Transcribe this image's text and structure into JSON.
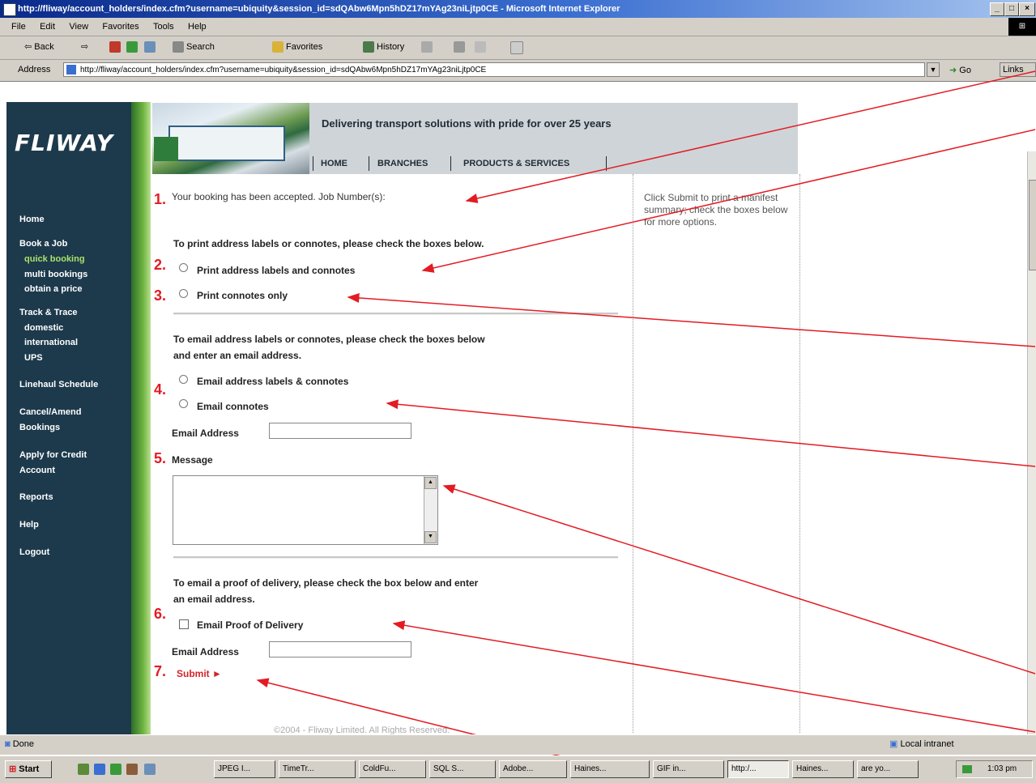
{
  "window": {
    "title": "http://fliway/account_holders/index.cfm?username=ubiquity&session_id=sdQAbw6Mpn5hDZ17mYAg23niLjtp0CE - Microsoft Internet Explorer",
    "minimize": "_",
    "maximize": "□",
    "close": "×"
  },
  "menu": {
    "items": [
      "File",
      "Edit",
      "View",
      "Favorites",
      "Tools",
      "Help"
    ]
  },
  "toolbar": {
    "back": "⇦ Back",
    "forward": "⇨",
    "search": "Search",
    "favorites": "Favorites",
    "history": "History"
  },
  "address": {
    "label": "Address",
    "value": "http://fliway/account_holders/index.cfm?username=ubiquity&session_id=sdQAbw6Mpn5hDZ17mYAg23niLjtp0CE",
    "go": "Go",
    "links": "Links"
  },
  "site": {
    "logo": "FLIWAY",
    "tagline": "Delivering transport solutions with pride for over 25 years",
    "topnav": [
      "HOME",
      "BRANCHES",
      "PRODUCTS & SERVICES"
    ]
  },
  "sidebar": {
    "items": [
      {
        "label": "Home",
        "active": false,
        "sub": false
      },
      {
        "label": "Book a Job",
        "active": false,
        "sub": false
      },
      {
        "label": "quick booking",
        "active": true,
        "sub": true
      },
      {
        "label": "multi bookings",
        "active": false,
        "sub": true
      },
      {
        "label": "obtain a price",
        "active": false,
        "sub": true
      },
      {
        "label": "Track & Trace",
        "active": false,
        "sub": false
      },
      {
        "label": "domestic",
        "active": false,
        "sub": true
      },
      {
        "label": "international",
        "active": false,
        "sub": true
      },
      {
        "label": "UPS",
        "active": false,
        "sub": true
      },
      {
        "label": "Linehaul Schedule",
        "active": false,
        "sub": false
      },
      {
        "label": "Cancel/Amend",
        "active": false,
        "sub": false
      },
      {
        "label": "Bookings",
        "active": false,
        "sub": false
      },
      {
        "label": "Apply for Credit",
        "active": false,
        "sub": false
      },
      {
        "label": "Account",
        "active": false,
        "sub": false
      },
      {
        "label": "Reports",
        "active": false,
        "sub": false
      },
      {
        "label": "Help",
        "active": false,
        "sub": false
      },
      {
        "label": "Logout",
        "active": false,
        "sub": false
      }
    ]
  },
  "form": {
    "accepted_text": "Your booking has been accepted. Job Number(s):",
    "print_heading": "To print address labels or connotes, please check the boxes below.",
    "print_labels": "Print address labels and connotes",
    "print_connotes": "Print connotes only",
    "email_heading_1": "To email address labels or connotes, please check the boxes below",
    "email_heading_2": "and enter an email address.",
    "email_labels": "Email address labels & connotes",
    "email_connotes": "Email connotes",
    "email_address_label": "Email Address",
    "message_label": "Message",
    "pod_heading_1": "To email a proof of delivery, please check the box below and enter",
    "pod_heading_2": "an email address.",
    "pod_checkbox": "Email Proof of Delivery",
    "pod_email_label": "Email Address",
    "submit": "Submit ►",
    "footer": "©2004 - Fliway Limited. All Rights Reserved."
  },
  "help_text": "Click Submit to print a manifest summary; check the boxes below for more options.",
  "annotations": [
    "1.",
    "2.",
    "3.",
    "4.",
    "5.",
    "6.",
    "7."
  ],
  "status": {
    "text": "Done",
    "zone": "Local intranet"
  },
  "taskbar": {
    "start": "Start",
    "buttons": [
      "JPEG I...",
      "TimeTr...",
      "ColdFu...",
      "SQL S...",
      "Adobe...",
      "Haines...",
      "GIF in...",
      "http:/...",
      "Haines...",
      "are yo..."
    ],
    "active_index": 7,
    "clock": "1:03 pm"
  },
  "colors": {
    "sidebar": "#1d3a4c",
    "sidebar_active": "#a9e06a",
    "accent_red": "#e31b23",
    "submit": "#d2232a",
    "title_blue": "#0a2a8a",
    "chrome": "#d4d0c8"
  }
}
